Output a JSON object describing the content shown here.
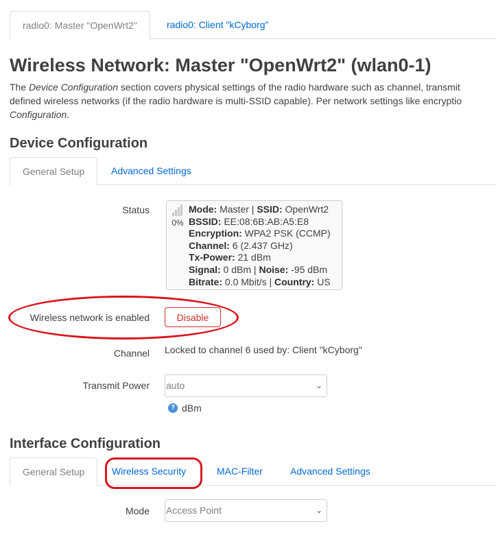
{
  "top_tabs": [
    {
      "label": "radio0: Master \"OpenWrt2\"",
      "active": true
    },
    {
      "label": "radio0: Client \"kCyborg\"",
      "active": false
    }
  ],
  "page_title": "Wireless Network: Master \"OpenWrt2\" (wlan0-1)",
  "description": {
    "line1_pre": "The ",
    "line1_em": "Device Configuration",
    "line1_post": " section covers physical settings of the radio hardware such as channel, transmit",
    "line2": "defined wireless networks (if the radio hardware is multi-SSID capable). Per network settings like encryptio",
    "line3_em": "Configuration",
    "line3_post": "."
  },
  "device_config": {
    "heading": "Device Configuration",
    "tabs": [
      {
        "label": "General Setup",
        "active": true
      },
      {
        "label": "Advanced Settings",
        "active": false
      }
    ],
    "status": {
      "label": "Status",
      "signal_percent": "0%",
      "mode_key": "Mode:",
      "mode_val": " Master | ",
      "ssid_key": "SSID:",
      "ssid_val": " OpenWrt2",
      "bssid_key": "BSSID:",
      "bssid_val": " EE:08:6B:AB:A5:E8",
      "enc_key": "Encryption:",
      "enc_val": " WPA2 PSK (CCMP)",
      "chan_key": "Channel:",
      "chan_val": " 6 (2.437 GHz)",
      "tx_key": "Tx-Power:",
      "tx_val": " 21 dBm",
      "sig_key": "Signal:",
      "sig_val": " 0 dBm | ",
      "noise_key": "Noise:",
      "noise_val": " -95 dBm",
      "bitrate_key": "Bitrate:",
      "bitrate_val": " 0.0 Mbit/s | ",
      "country_key": "Country:",
      "country_val": " US"
    },
    "enabled_label": "Wireless network is enabled",
    "disable_button": "Disable",
    "channel_label": "Channel",
    "channel_value": "Locked to channel 6 used by: Client \"kCyborg\"",
    "txpower_label": "Transmit Power",
    "txpower_value": "auto",
    "txpower_unit": "dBm"
  },
  "interface_config": {
    "heading": "Interface Configuration",
    "tabs": [
      {
        "label": "General Setup",
        "active": true
      },
      {
        "label": "Wireless Security",
        "active": false
      },
      {
        "label": "MAC-Filter",
        "active": false
      },
      {
        "label": "Advanced Settings",
        "active": false
      }
    ],
    "mode_label": "Mode",
    "mode_value": "Access Point"
  },
  "colors": {
    "link": "#0069d6",
    "danger": "#c9302c",
    "annotation": "#d9161f"
  }
}
